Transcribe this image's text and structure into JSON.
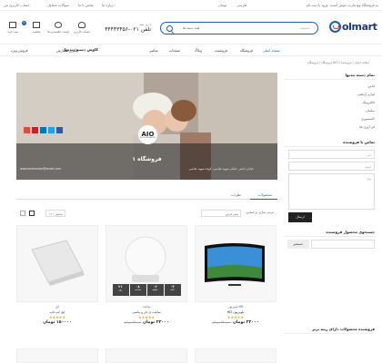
{
  "topbar": {
    "welcome": "به فروشگاه وودمارت خوش آمدید، ورود یا ثبت نام",
    "language": "فارسی",
    "currency": "تومان",
    "links": [
      "درباره ما",
      "تماس با ما",
      "سوالات متداول",
      "حساب کاربری من"
    ]
  },
  "header": {
    "logo_text": "olmart",
    "search_placeholder": "جستجو...",
    "search_category": "همه دسته ها",
    "phone_caption": "۷ روز هفته",
    "phone_number": "تلفن ۰۲۱-۴۴۴۴۳۴۵۶",
    "icons": [
      {
        "label": "حساب کاربری",
        "icon": "user-icon"
      },
      {
        "label": "لیست علاقمندی ها",
        "icon": "heart-icon"
      },
      {
        "label": "مقایسه",
        "icon": "compare-icon"
      },
      {
        "label": "سبد خرید",
        "icon": "cart-icon",
        "badge": "0"
      }
    ]
  },
  "nav": {
    "categories_button": "کاوش دسته بندیها",
    "items": [
      "صفحه اصلی",
      "فروشگاه",
      "فروشنده",
      "وبلاگ",
      "صفحات",
      "عناصر"
    ],
    "track": "پیگیری سفارش",
    "sale": "فروش ویژه"
  },
  "breadcrumb": "صفحه اصلی / فروشنده / AIO فروشگاه / فروشگاه",
  "sidebar": {
    "categories_title": "تمام دسته بندیها",
    "categories": [
      "لباس",
      "لوازم آرایشی",
      "الکترونیک",
      "مبلمان",
      "اکسسوری",
      "فن آوری ها"
    ],
    "contact_title": "تماس با فروشنده",
    "fields": [
      "نام",
      "ایمیل",
      "پیام"
    ],
    "send_label": "ارسال",
    "search_title": "جستجوی محصول فروشنده",
    "search_button": "جستجو",
    "best_title": "فروشنده محصولات دارای رتبه برتر"
  },
  "store": {
    "logo_text": "AIO",
    "logo_sub": "ALL IN ONE FASHION",
    "name": "فروشگاه ۱",
    "address": "خیابان دانش، خیابان شهید عباسی، کوچه شهید عباسی",
    "email": "woomartvendor@email.com",
    "tabs": [
      "محصولات",
      "نظرات"
    ]
  },
  "filters": {
    "sort_label": "مرتب سازی بر اساس:",
    "sort_value": "پیش فرض",
    "per_page": "نمایش : ۱۲"
  },
  "products": [
    {
      "brand": "HD تلویزیون",
      "name": "تلویزیون HD",
      "stars": "★★★★★",
      "old_price": "۲۳۰۰۰۰ تومان",
      "price": "۲۲۰۰۰ تومان"
    },
    {
      "brand": "ساعت",
      "name": "ساعت ی دار و ماسی",
      "stars": "★★★★★",
      "old_price": "۲۲۰۰۰ تومان",
      "price": "۲۳۰۰۰ تومان",
      "countdown": [
        {
          "v": "۲۱",
          "l": "روز"
        },
        {
          "v": "۰۸",
          "l": "ساعت"
        },
        {
          "v": "۰۶",
          "l": "دقیقه"
        },
        {
          "v": "۰۳",
          "l": "ثانیه"
        }
      ]
    },
    {
      "brand": "اپل",
      "name": "اپل لپ تاپ",
      "stars": "★★★★★",
      "old_price": "",
      "price": "۱۵۰۰۰۰ تومان"
    }
  ],
  "colors": {
    "accent": "#1a5fb4",
    "dark": "#222222"
  }
}
